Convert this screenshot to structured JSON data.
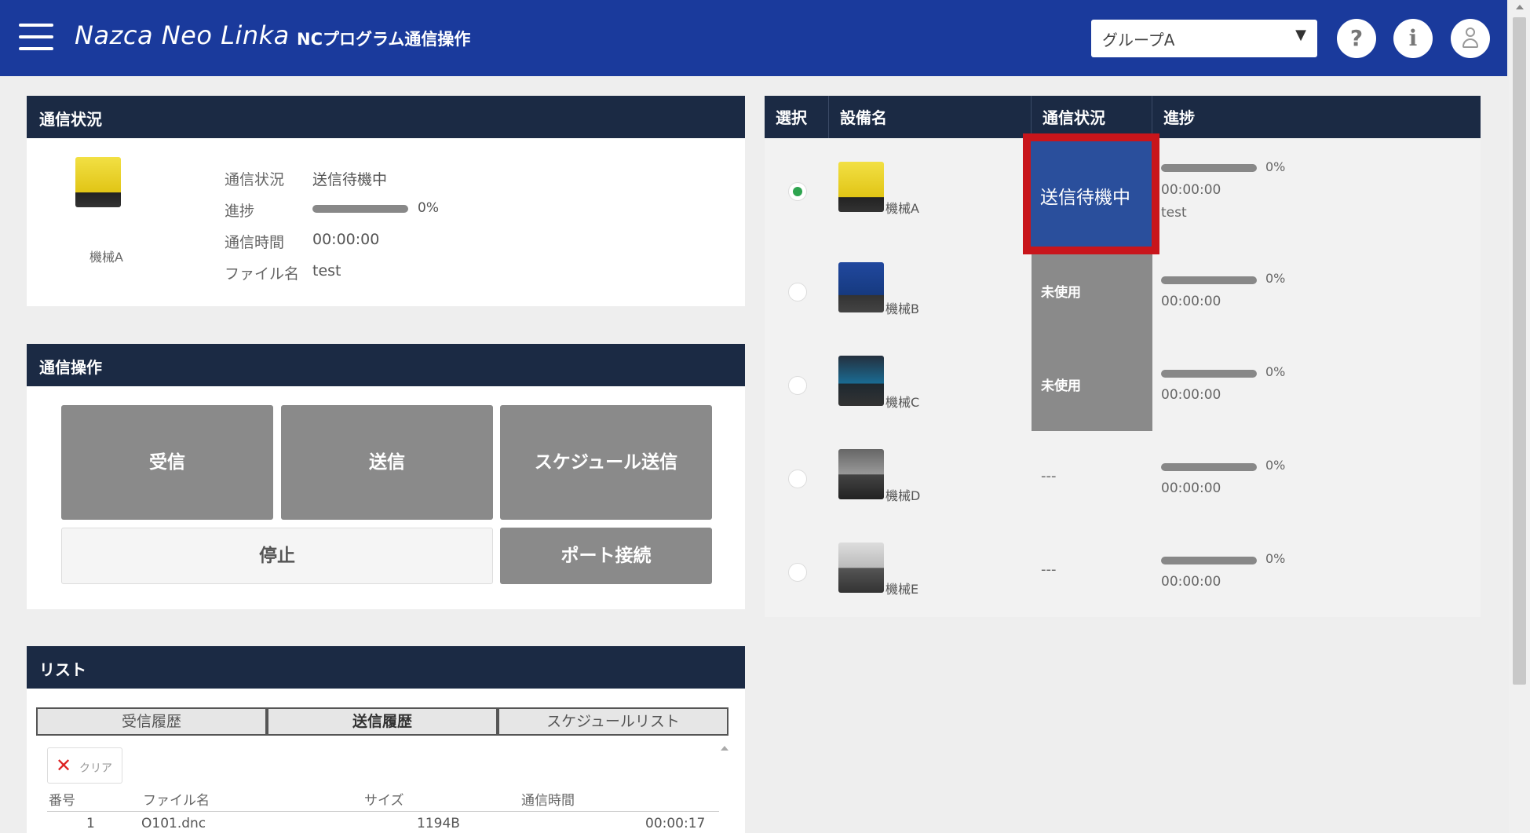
{
  "header": {
    "brand": "Nazca Neo Linka",
    "page_title": "NCプログラム通信操作",
    "group_selected": "グループA",
    "help_icon": "?",
    "info_icon": "i"
  },
  "status_panel": {
    "title": "通信状況",
    "machine_name": "機械A",
    "rows": {
      "status_label": "通信状況",
      "status_value": "送信待機中",
      "progress_label": "進捗",
      "progress_value": "0%",
      "progress_fraction": 0,
      "time_label": "通信時間",
      "time_value": "00:00:00",
      "file_label": "ファイル名",
      "file_value": "test"
    }
  },
  "ops_panel": {
    "title": "通信操作",
    "receive": "受信",
    "send": "送信",
    "schedule_send": "スケジュール送信",
    "stop": "停止",
    "port_connect": "ポート接続"
  },
  "list_panel": {
    "title": "リスト",
    "tabs": [
      "受信履歴",
      "送信履歴",
      "スケジュールリスト"
    ],
    "clear": "クリア",
    "columns": [
      "番号",
      "ファイル名",
      "サイズ",
      "通信時間"
    ],
    "rows": [
      {
        "no": "1",
        "file": "O101.dnc",
        "size": "1194B",
        "time": "00:00:17"
      }
    ]
  },
  "machine_table": {
    "columns": [
      "選択",
      "設備名",
      "通信状況",
      "進捗"
    ],
    "rows": [
      {
        "name": "機械A",
        "selected": true,
        "status": "送信待機中",
        "progress": "0%",
        "time": "00:00:00",
        "file": "test",
        "thumb": "thumb-yellow"
      },
      {
        "name": "機械B",
        "selected": false,
        "status": "未使用",
        "progress": "0%",
        "time": "00:00:00",
        "file": "",
        "thumb": "thumb-blue"
      },
      {
        "name": "機械C",
        "selected": false,
        "status": "未使用",
        "progress": "0%",
        "time": "00:00:00",
        "file": "",
        "thumb": "thumb-dark"
      },
      {
        "name": "機械D",
        "selected": false,
        "status": "---",
        "progress": "0%",
        "time": "00:00:00",
        "file": "",
        "thumb": "thumb-grey"
      },
      {
        "name": "機械E",
        "selected": false,
        "status": "---",
        "progress": "0%",
        "time": "00:00:00",
        "file": "",
        "thumb": "thumb-light"
      }
    ]
  },
  "colors": {
    "header_bg": "#1a3a9c",
    "panel_header_bg": "#1b2a44",
    "highlight_border": "#c8151b",
    "active_status_bg": "#2a4f9c",
    "selected_radio": "#2ea44f"
  }
}
